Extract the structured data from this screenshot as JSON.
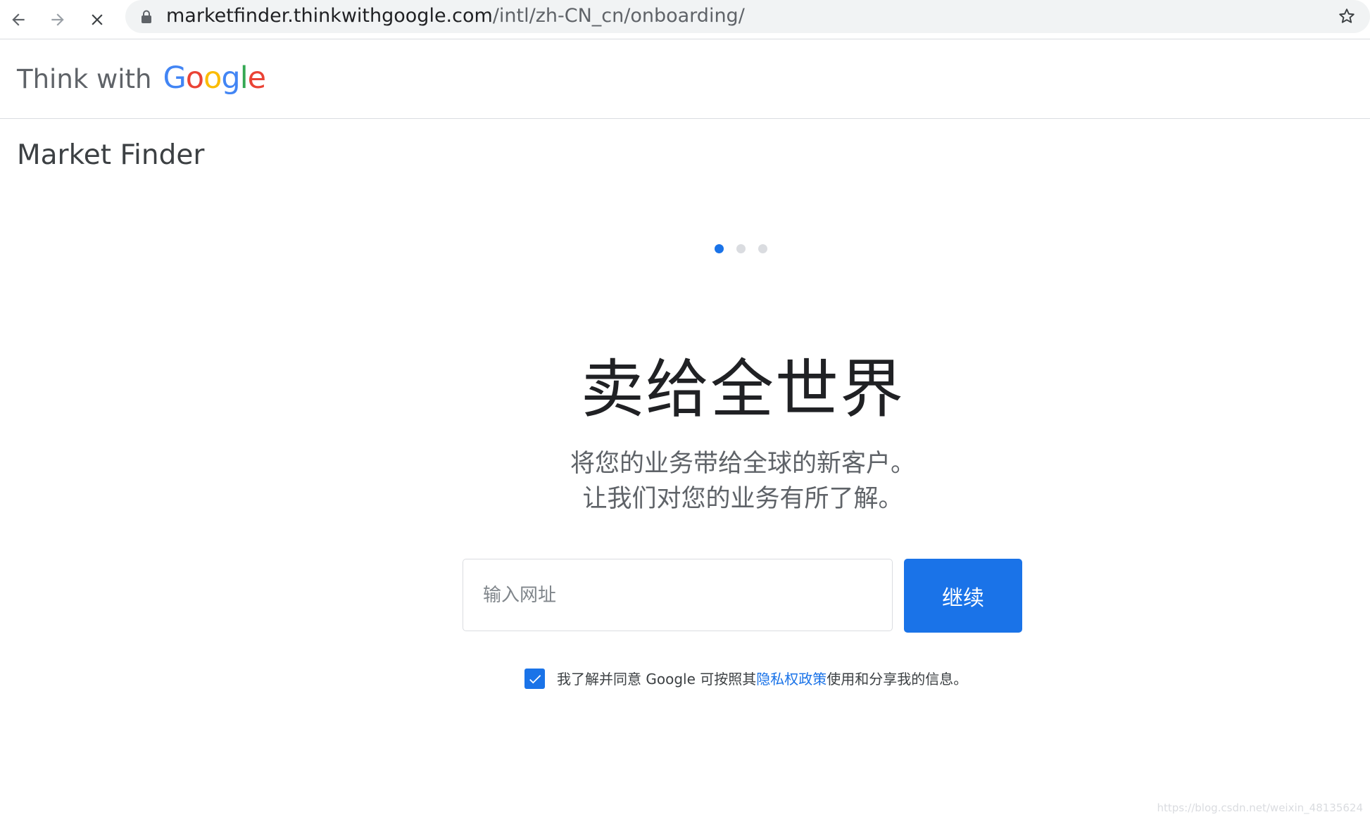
{
  "browser": {
    "url_host": "marketfinder.thinkwithgoogle.com",
    "url_path": "/intl/zh-CN_cn/onboarding/",
    "icons": [
      "back-arrow-icon",
      "forward-arrow-icon",
      "stop-loading-icon",
      "lock-icon",
      "bookmark-star-icon"
    ]
  },
  "header": {
    "brand_prefix": "Think with",
    "brand_letters": [
      "G",
      "o",
      "o",
      "g",
      "l",
      "e"
    ],
    "brand_colors": [
      "#4285F4",
      "#EA4335",
      "#FBBC05",
      "#4285F4",
      "#34A853",
      "#EA4335"
    ]
  },
  "product_name": "Market Finder",
  "progress": {
    "current_step": 1,
    "total_steps": 3
  },
  "hero": {
    "title": "卖给全世界",
    "subtitle_line1": "将您的业务带给全球的新客户。",
    "subtitle_line2": "让我们对您的业务有所了解。"
  },
  "form": {
    "url_placeholder": "输入网址",
    "url_value": "",
    "continue_label": "继续"
  },
  "consent": {
    "checked": true,
    "text_before": "我了解并同意 Google 可按照其",
    "link_text": "隐私权政策",
    "text_after": "使用和分享我的信息。"
  },
  "watermark": "https://blog.csdn.net/weixin_48135624",
  "colors": {
    "accent": "#1a73e8",
    "inactive_dot": "#dadce0"
  }
}
